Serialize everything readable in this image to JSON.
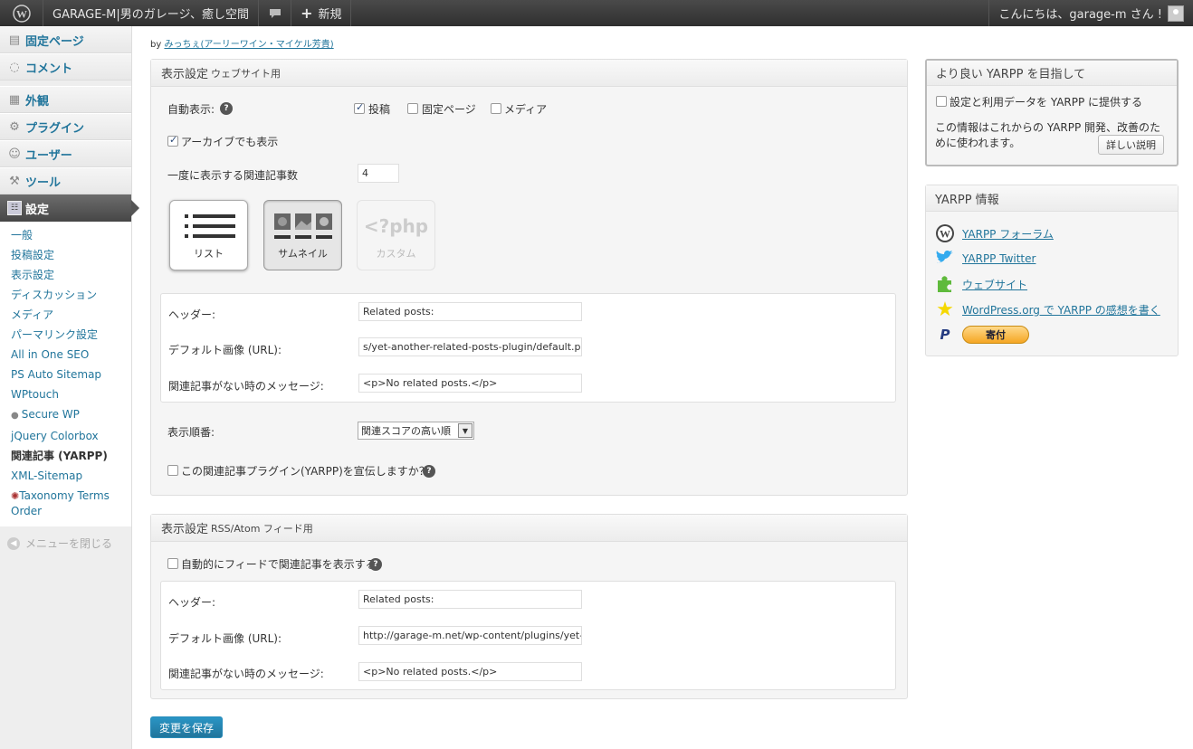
{
  "adminbar": {
    "site_title": "GARAGE-M|男のガレージ、癒し空間",
    "new_label": "新規",
    "greeting": "こんにちは、garage-m さん !"
  },
  "sidebar": {
    "top_items": [
      {
        "label": "固定ページ",
        "icon": "page-icon"
      },
      {
        "label": "コメント",
        "icon": "comment-icon"
      }
    ],
    "items": [
      {
        "label": "外観",
        "icon": "appearance-icon"
      },
      {
        "label": "プラグイン",
        "icon": "plugin-icon"
      },
      {
        "label": "ユーザー",
        "icon": "users-icon"
      },
      {
        "label": "ツール",
        "icon": "tools-icon"
      }
    ],
    "current": {
      "label": "設定",
      "icon": "settings-icon"
    },
    "submenu": [
      "一般",
      "投稿設定",
      "表示設定",
      "ディスカッション",
      "メディア",
      "パーマリンク設定",
      "All in One SEO",
      "PS Auto Sitemap",
      "WPtouch",
      "Secure WP",
      "jQuery Colorbox",
      "関連記事 (YARPP)",
      "XML-Sitemap",
      "Taxonomy Terms Order"
    ],
    "submenu_current": "関連記事 (YARPP)",
    "collapse": "メニューを閉じる"
  },
  "byline": {
    "prefix": "by",
    "author": "みっちぇ(アーリーワイン・マイケル芳貴)"
  },
  "website_box": {
    "title": "表示設定",
    "title_small": "ウェブサイト用",
    "auto_display_label": "自動表示:",
    "post_types": [
      {
        "label": "投稿",
        "checked": true
      },
      {
        "label": "固定ページ",
        "checked": false
      },
      {
        "label": "メディア",
        "checked": false
      }
    ],
    "archive_label": "アーカイブでも表示",
    "archive_checked": true,
    "count_label": "一度に表示する関連記事数",
    "count_value": "4",
    "templates": [
      {
        "label": "リスト",
        "state": "raised"
      },
      {
        "label": "サムネイル",
        "state": "pressed"
      },
      {
        "label": "カスタム",
        "state": "disabled",
        "code": "<?php"
      }
    ],
    "header_label": "ヘッダー:",
    "header_value": "Related posts:",
    "default_image_label": "デフォルト画像 (URL):",
    "default_image_value": "s/yet-another-related-posts-plugin/default.png",
    "no_related_label": "関連記事がない時のメッセージ:",
    "no_related_value": "<p>No related posts.</p>",
    "order_label": "表示順番:",
    "order_value": "関連スコアの高い順",
    "promote_label": "この関連記事プラグイン(YARPP)を宣伝しますか？"
  },
  "rss_box": {
    "title": "表示設定",
    "title_small": "RSS/Atom フィード用",
    "auto_feed_label": "自動的にフィードで関連記事を表示する",
    "header_label": "ヘッダー:",
    "header_value": "Related posts:",
    "default_image_label": "デフォルト画像 (URL):",
    "default_image_value": "http://garage-m.net/wp-content/plugins/yet-ar",
    "no_related_label": "関連記事がない時のメッセージ:",
    "no_related_value": "<p>No related posts.</p>"
  },
  "save_label": "変更を保存",
  "better_box": {
    "title": "より良い YARPP を目指して",
    "optin_label": "設定と利用データを YARPP に提供する",
    "desc": "この情報はこれからの YARPP 開発、改善のために使われます。",
    "more_button": "詳しい説明"
  },
  "info_box": {
    "title": "YARPP 情報",
    "links": [
      "YARPP フォーラム",
      "YARPP Twitter",
      "ウェブサイト",
      "WordPress.org で YARPP の感想を書く"
    ],
    "donate": "寄付"
  }
}
